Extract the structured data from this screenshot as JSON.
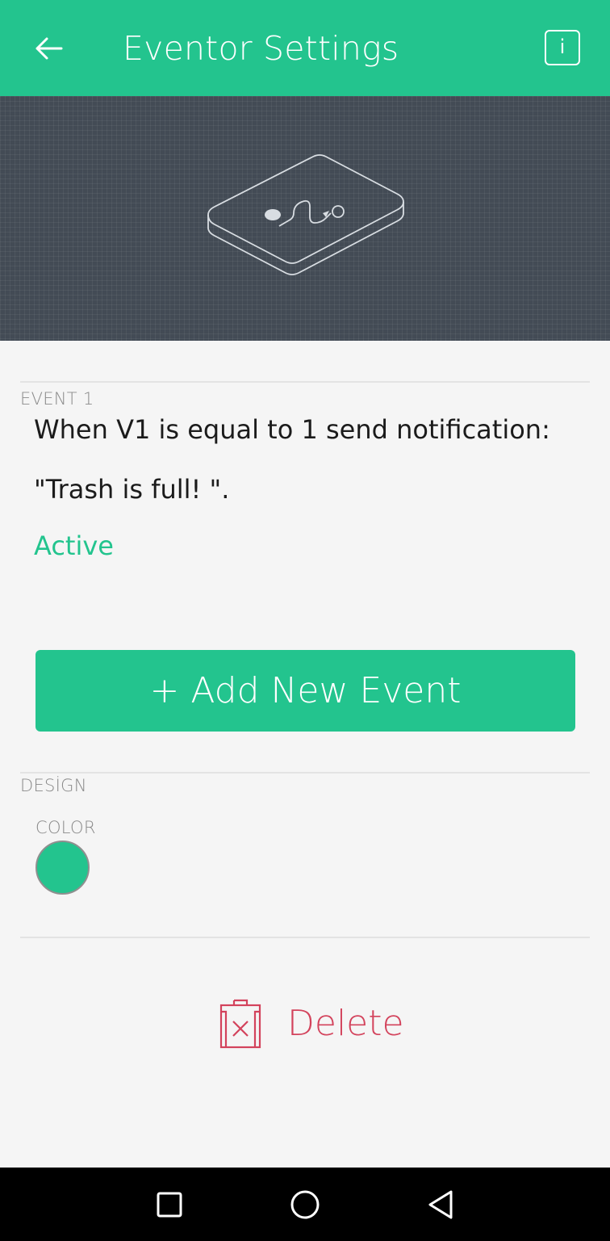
{
  "header": {
    "title": "Eventor Settings",
    "back_icon": "arrow-left-icon",
    "info_label": "i"
  },
  "event": {
    "label": "EVENT 1",
    "line1": "When V1 is equal to 1 send notification:",
    "line2": "\"Trash is full! \".",
    "status": "Active"
  },
  "add_button": {
    "label": "+ Add New Event"
  },
  "design": {
    "label": "DESİGN",
    "color_label": "COLOR",
    "color_value": "#23c48e"
  },
  "delete": {
    "label": "Delete",
    "icon": "trash-icon"
  },
  "colors": {
    "accent": "#23c48e",
    "danger": "#d3435c",
    "hero_bg": "#434b55"
  },
  "nav": {
    "icons": [
      "square-icon",
      "circle-icon",
      "triangle-back-icon"
    ]
  }
}
